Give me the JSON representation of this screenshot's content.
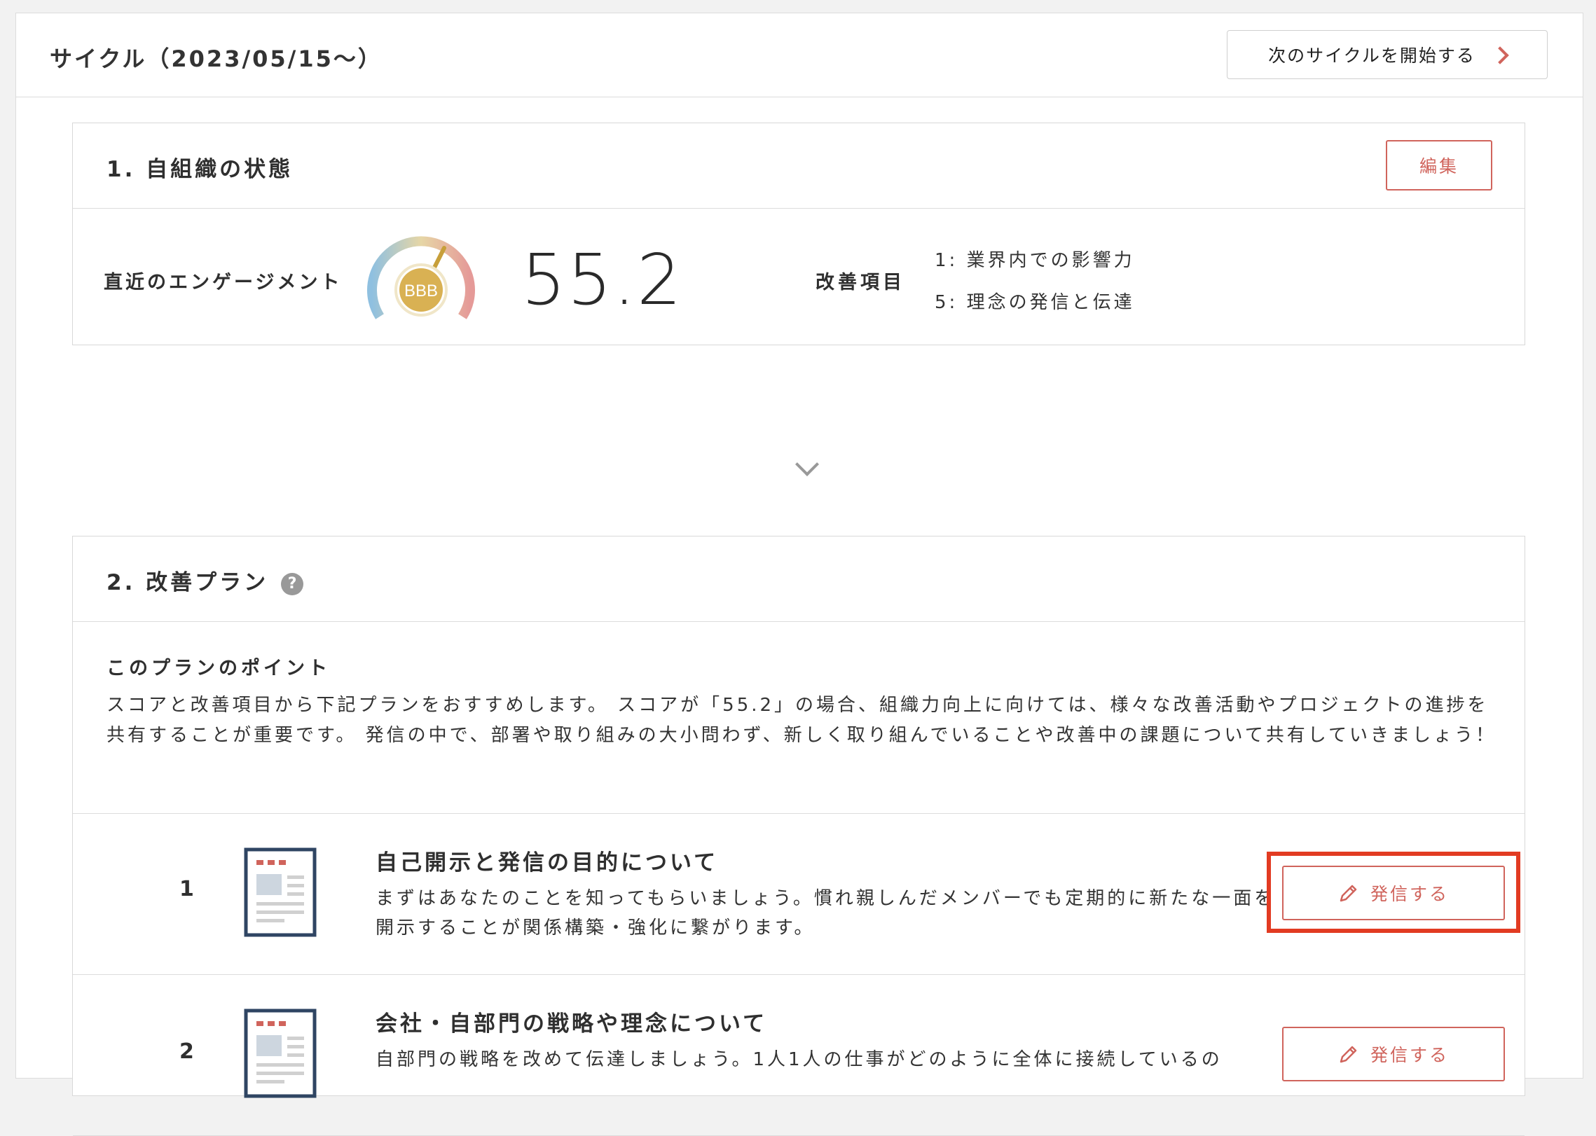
{
  "header": {
    "cycle_title": "サイクル（2023/05/15〜）",
    "next_cycle_label": "次のサイクルを開始する"
  },
  "section1": {
    "title": "1. 自組織の状態",
    "edit_label": "編集",
    "engagement_label": "直近のエンゲージメント",
    "rating": "BBB",
    "score": "55.2",
    "improvement_label": "改善項目",
    "improvement_items": [
      "1: 業界内での影響力",
      "5: 理念の発信と伝達"
    ]
  },
  "section2": {
    "title": "2. 改善プラン",
    "help_glyph": "?",
    "point_title": "このプランのポイント",
    "point_text": "スコアと改善項目から下記プランをおすすめします。 スコアが「55.2」の場合、組織力向上に向けては、様々な改善活動やプロジェクトの進捗を共有することが重要です。 発信の中で、部署や取り組みの大小問わず、新しく取り組んでいることや改善中の課題について共有していきましょう！",
    "plans": [
      {
        "number": "1",
        "title": "自己開示と発信の目的について",
        "description": "まずはあなたのことを知ってもらいましょう。慣れ親しんだメンバーでも定期的に新たな一面を開示することが関係構築・強化に繋がります。",
        "button_label": "発信する"
      },
      {
        "number": "2",
        "title": "会社・自部門の戦略や理念について",
        "description": "自部門の戦略を改めて伝達しましょう。1人1人の仕事がどのように全体に接続しているの",
        "button_label": "発信する"
      }
    ]
  },
  "colors": {
    "accent": "#d0645c",
    "highlight": "#e23b22",
    "gauge_center": "#d9b153"
  },
  "icons": [
    "chevron-right-icon",
    "gauge-icon",
    "chevron-down-icon",
    "help-icon",
    "document-icon",
    "pencil-icon"
  ]
}
